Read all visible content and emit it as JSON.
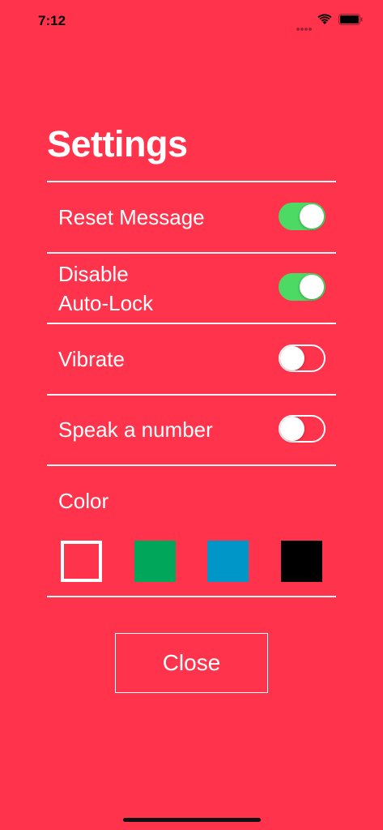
{
  "status_bar": {
    "time": "7:12"
  },
  "title": "Settings",
  "settings": [
    {
      "label": "Reset Message",
      "state": "on"
    },
    {
      "label_line1": "Disable",
      "label_line2": "Auto-Lock",
      "state": "on"
    },
    {
      "label": "Vibrate",
      "state": "off"
    },
    {
      "label": "Speak a number",
      "state": "off"
    }
  ],
  "color_section": {
    "label": "Color",
    "swatches": [
      {
        "name": "white-outline",
        "color": "#ffffff"
      },
      {
        "name": "green",
        "color": "#00a65a"
      },
      {
        "name": "blue",
        "color": "#0096c8"
      },
      {
        "name": "black",
        "color": "#000000"
      }
    ]
  },
  "close_label": "Close",
  "colors": {
    "background": "#ff334b",
    "toggle_on": "#4cd964"
  }
}
